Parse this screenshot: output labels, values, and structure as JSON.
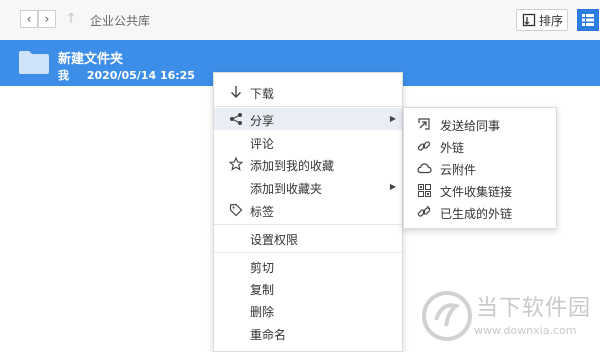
{
  "toolbar": {
    "breadcrumb": "企业公共库",
    "sort_label": "排序",
    "back_glyph": "‹",
    "forward_glyph": "›",
    "up_glyph": "↑"
  },
  "file": {
    "name": "新建文件夹",
    "owner": "我",
    "modified": "2020/05/14 16:25"
  },
  "context_menu": {
    "items": [
      {
        "label": "下载",
        "icon": "download-icon"
      },
      {
        "label": "分享",
        "icon": "share-icon",
        "has_submenu": true,
        "highlighted": true
      },
      {
        "label": "评论"
      },
      {
        "label": "添加到我的收藏",
        "icon": "star-icon"
      },
      {
        "label": "添加到收藏夹",
        "has_submenu": true
      },
      {
        "label": "标签",
        "icon": "tag-icon"
      },
      {
        "label": "设置权限"
      },
      {
        "label": "剪切"
      },
      {
        "label": "复制"
      },
      {
        "label": "删除"
      },
      {
        "label": "重命名"
      }
    ]
  },
  "share_submenu": {
    "items": [
      {
        "label": "发送给同事",
        "icon": "send-icon"
      },
      {
        "label": "外链",
        "icon": "link-icon"
      },
      {
        "label": "云附件",
        "icon": "cloud-icon"
      },
      {
        "label": "文件收集链接",
        "icon": "grid-icon"
      },
      {
        "label": "已生成的外链",
        "icon": "link-generated-icon"
      }
    ]
  },
  "watermark": {
    "title": "当下软件园",
    "url": "www.downxia.com"
  },
  "colors": {
    "accent": "#2b7de0",
    "selected_row": "#3d8ee8",
    "menu_highlight": "#e9eef5"
  }
}
